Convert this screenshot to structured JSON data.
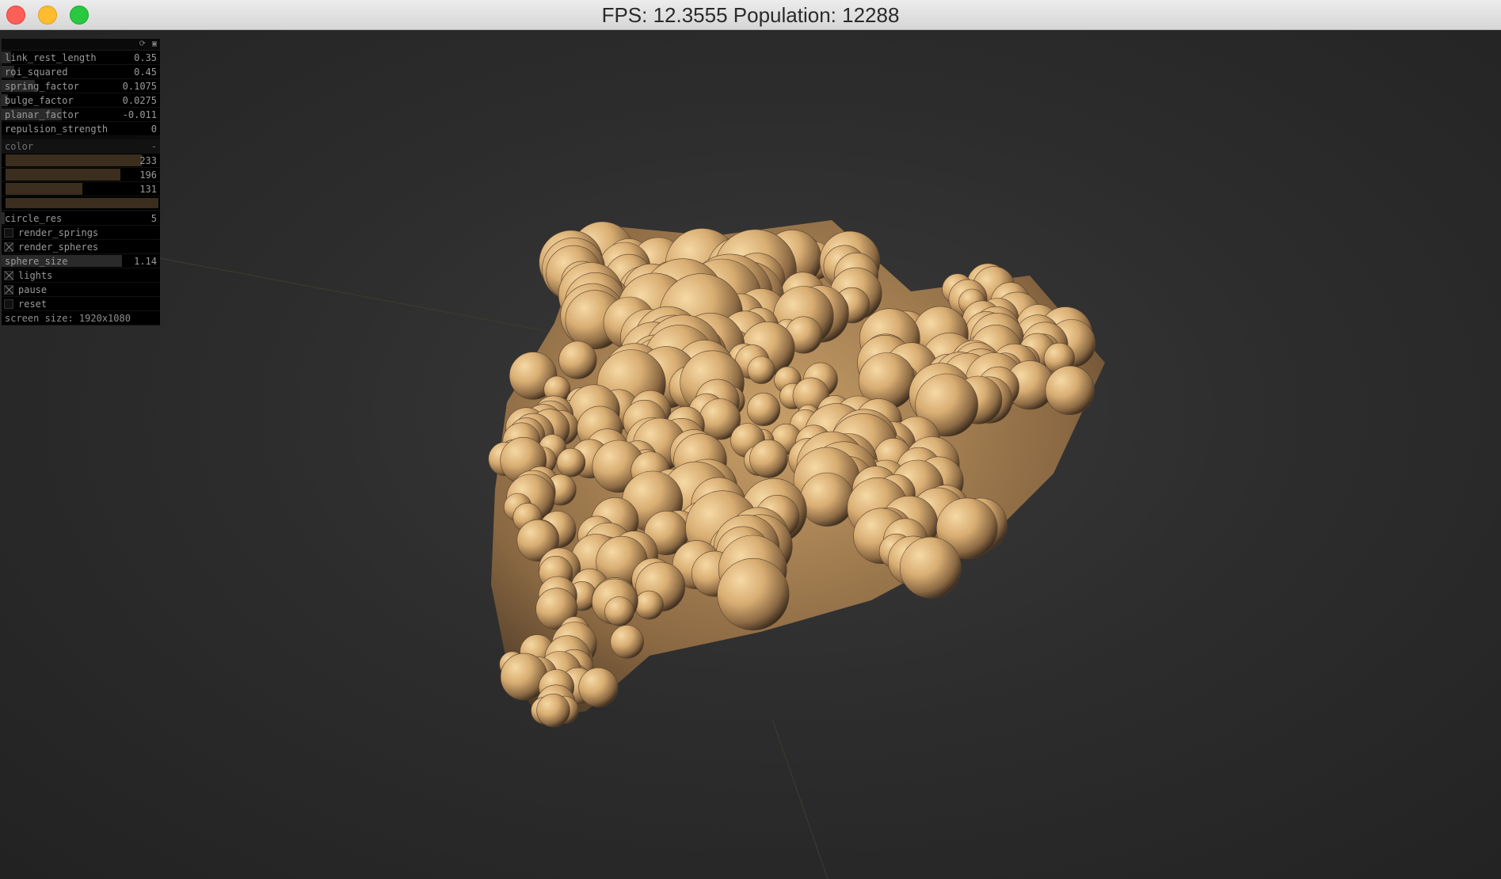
{
  "window": {
    "title": "FPS: 12.3555 Population: 12288",
    "buttons": [
      "close",
      "minimize",
      "maximize"
    ]
  },
  "panel": {
    "header_icons": [
      "refresh-icon",
      "minimize-icon"
    ],
    "params": [
      {
        "name": "link_rest_length",
        "value": "0.35",
        "fill": 0.06
      },
      {
        "name": "roi_squared",
        "value": "0.45",
        "fill": 0.08
      },
      {
        "name": "spring_factor",
        "value": "0.1075",
        "fill": 0.21
      },
      {
        "name": "bulge_factor",
        "value": "0.0275",
        "fill": 0.04
      },
      {
        "name": "planar_factor",
        "value": "-0.011",
        "fill": 0.38
      },
      {
        "name": "repulsion_strength",
        "value": "0",
        "fill": 0.0
      }
    ],
    "color_group": {
      "label": "color",
      "collapse_symbol": "-",
      "channels": [
        {
          "value": "233",
          "fill": 0.914
        },
        {
          "value": "196",
          "fill": 0.769
        },
        {
          "value": "131",
          "fill": 0.514
        }
      ],
      "swatch": "#e9c483"
    },
    "circle_res": {
      "name": "circle_res",
      "value": "5",
      "fill": 0.02
    },
    "toggles": [
      {
        "name": "render_springs",
        "checked": false
      },
      {
        "name": "render_spheres",
        "checked": true
      }
    ],
    "sphere_size": {
      "name": "sphere_size",
      "value": "1.14",
      "fill": 0.76
    },
    "toggles2": [
      {
        "name": "lights",
        "checked": true
      },
      {
        "name": "pause",
        "checked": true
      },
      {
        "name": "reset",
        "checked": false
      }
    ],
    "screen_size": "screen size: 1920x1080"
  },
  "colors": {
    "blob_light": "#f1cf94",
    "blob_mid": "#c9a06a",
    "blob_dark": "#4a3826",
    "background": "#2b2b2b"
  }
}
